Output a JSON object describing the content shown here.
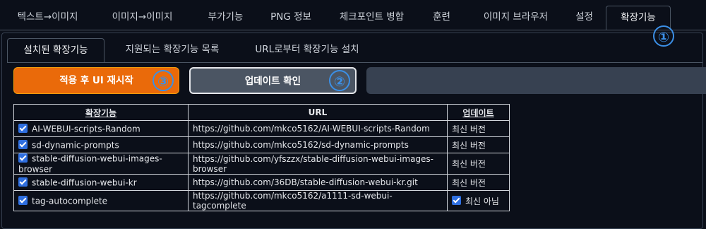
{
  "top_tabs": [
    {
      "label": "텍스트→이미지"
    },
    {
      "label": "이미지→이미지"
    },
    {
      "label": "부가기능"
    },
    {
      "label": "PNG 정보"
    },
    {
      "label": "체크포인트 병합"
    },
    {
      "label": "훈련"
    },
    {
      "label": "이미지 브라우저"
    },
    {
      "label": "설정"
    },
    {
      "label": "확장기능"
    }
  ],
  "sub_tabs": [
    {
      "label": "설치된 확장기능"
    },
    {
      "label": "지원되는 확장기능 목록"
    },
    {
      "label": "URL로부터 확장기능 설치"
    }
  ],
  "buttons": {
    "apply_label": "적용 후 UI 재시작",
    "check_label": "업데이트 확인"
  },
  "badges": {
    "one": "①",
    "two": "②",
    "three": "③"
  },
  "table": {
    "headers": [
      "확장기능",
      "URL",
      "업데이트"
    ],
    "rows": [
      {
        "name": "AI-WEBUI-scripts-Random",
        "url": "https://github.com/mkco5162/AI-WEBUI-scripts-Random",
        "update": "최신 버전",
        "update_checkbox": false
      },
      {
        "name": "sd-dynamic-prompts",
        "url": "https://github.com/mkco5162/sd-dynamic-prompts",
        "update": "최신 버전",
        "update_checkbox": false
      },
      {
        "name": "stable-diffusion-webui-images-browser",
        "url": "https://github.com/yfszzx/stable-diffusion-webui-images-browser",
        "update": "최신 버전",
        "update_checkbox": false
      },
      {
        "name": "stable-diffusion-webui-kr",
        "url": "https://github.com/36DB/stable-diffusion-webui-kr.git",
        "update": "최신 버전",
        "update_checkbox": false
      },
      {
        "name": "tag-autocomplete",
        "url": "https://github.com/mkco5162/a1111-sd-webui-tagcomplete",
        "update": "최신 아님",
        "update_checkbox": true
      }
    ]
  },
  "colors": {
    "accent": "#ea6a0a",
    "badge": "#3b8fe6",
    "checkbox": "#2f6fe0"
  }
}
